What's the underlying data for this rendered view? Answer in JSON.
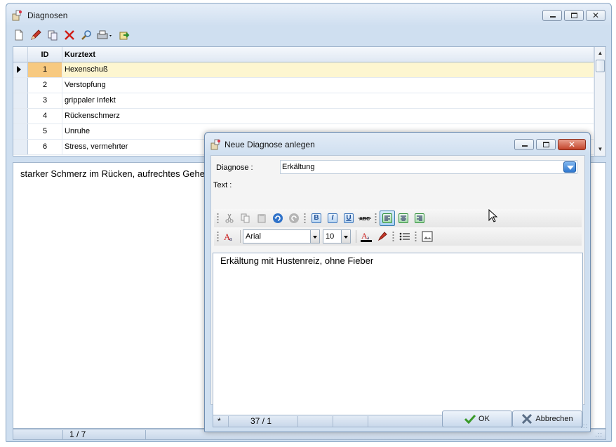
{
  "main": {
    "title": "Diagnosen",
    "grid": {
      "headers": {
        "id": "ID",
        "kurztext": "Kurztext"
      },
      "rows": [
        {
          "id": "1",
          "text": "Hexenschuß"
        },
        {
          "id": "2",
          "text": "Verstopfung"
        },
        {
          "id": "3",
          "text": "grippaler Infekt"
        },
        {
          "id": "4",
          "text": "Rückenschmerz"
        },
        {
          "id": "5",
          "text": "Unruhe"
        },
        {
          "id": "6",
          "text": "Stress, vermehrter"
        }
      ]
    },
    "description": "starker Schmerz im Rücken, aufrechtes Gehen",
    "status_position": "1 / 7"
  },
  "dialog": {
    "title": "Neue Diagnose anlegen",
    "diagnose_label": "Diagnose :",
    "diagnose_value": "Erkältung",
    "text_label": "Text :",
    "font_name": "Arial",
    "font_size": "10",
    "editor_text": "Erkältung mit Hustenreiz, ohne Fieber",
    "status_marker": "*",
    "status_position": "37 / 1",
    "ok_label": "OK",
    "cancel_label": "Abbrechen"
  },
  "colors": {
    "selected_row": "#fdf6d0",
    "selected_id_cell": "#f7c980",
    "window_frame": "#cfdff0",
    "close_button": "#c3442a"
  }
}
